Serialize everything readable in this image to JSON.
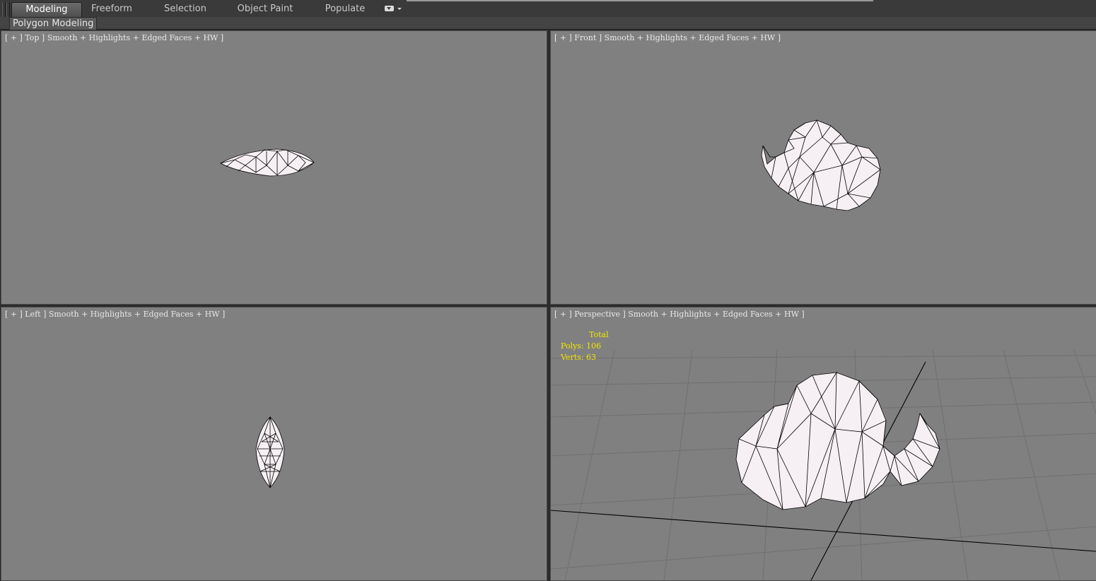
{
  "ribbon": {
    "tabs": [
      {
        "label": "Modeling",
        "active": true
      },
      {
        "label": "Freeform",
        "active": false
      },
      {
        "label": "Selection",
        "active": false
      },
      {
        "label": "Object Paint",
        "active": false
      },
      {
        "label": "Populate",
        "active": false
      }
    ],
    "sub_label": "Polygon Modeling"
  },
  "viewports": {
    "top": {
      "label": "[ + ] Top ] Smooth + Highlights + Edged Faces + HW ]"
    },
    "front": {
      "label": "[ + ] Front ] Smooth + Highlights + Edged Faces + HW ]"
    },
    "left": {
      "label": "[ + ] Left ] Smooth + Highlights + Edged Faces + HW ]"
    },
    "perspective": {
      "label": "[ + ] Perspective ] Smooth + Highlights + Edged Faces + HW ]"
    }
  },
  "stats": {
    "total": "Total",
    "polys": "Polys: 106",
    "verts": "Verts: 63"
  },
  "colors": {
    "viewport_bg": "#808080",
    "stats_text": "#f2e600",
    "mesh_fill": "#f4eef2",
    "mesh_edge": "#000000"
  }
}
